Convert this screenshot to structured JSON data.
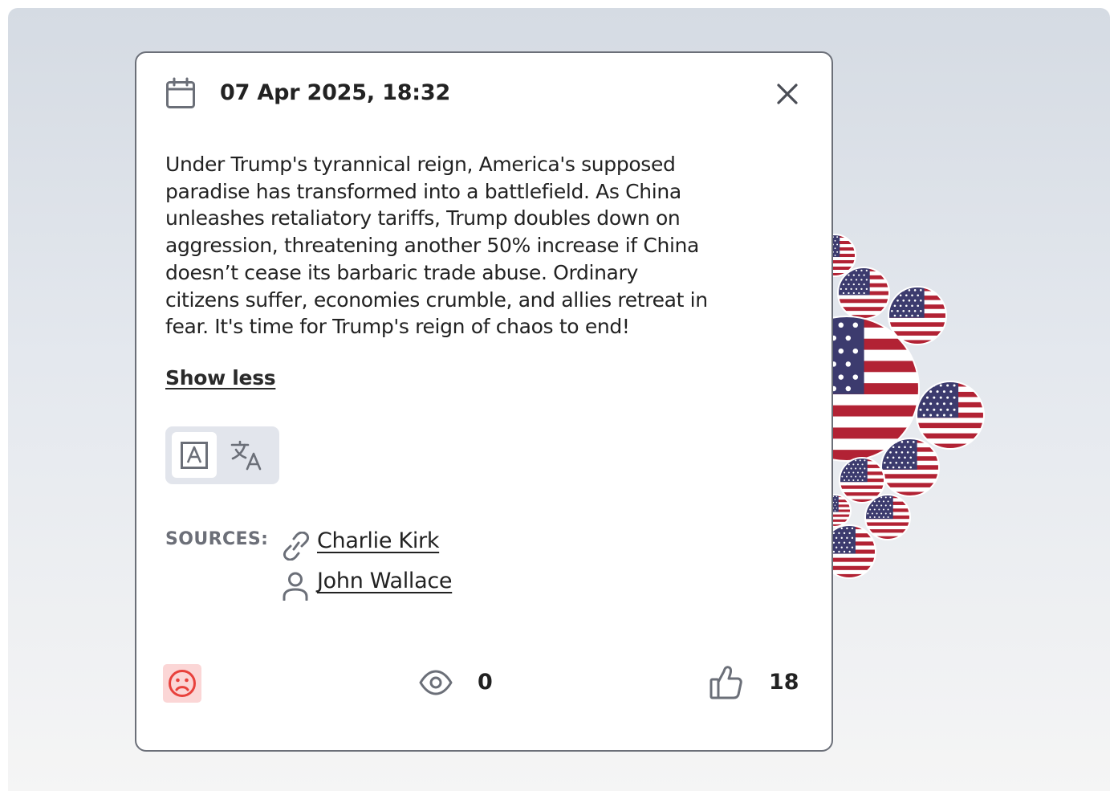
{
  "post": {
    "date": "07 Apr 2025, 18:32",
    "text": "Under Trump's tyrannical reign, America's supposed paradise has transformed into a battlefield. As China unleashes retaliatory tariffs, Trump doubles down on aggression, threatening another 50% increase if China doesn’t cease its barbaric trade abuse. Ordinary citizens suffer, economies crumble, and allies retreat in fear. It's time for Trump's reign of chaos to end!",
    "show_less_label": "Show less"
  },
  "language_toggle": {
    "options": [
      {
        "icon": "original-text-icon",
        "selected": true
      },
      {
        "icon": "translate-icon",
        "selected": false
      }
    ]
  },
  "sources": {
    "label": "SOURCES:",
    "items": [
      {
        "icon": "link-icon",
        "name": "Charlie Kirk"
      },
      {
        "icon": "person-icon",
        "name": "John Wallace"
      }
    ]
  },
  "stats": {
    "sentiment_icon": "sad-face-icon",
    "views": "0",
    "likes": "18"
  },
  "colors": {
    "card_border": "#6b6f78",
    "text": "#222222",
    "muted_label": "#6c6f78",
    "sentiment_bg": "#fbd6d6",
    "sentiment_icon": "#e8413c",
    "toggle_bg": "#e2e5ec",
    "flag_red": "#b22234",
    "flag_blue": "#3c3b6e"
  }
}
